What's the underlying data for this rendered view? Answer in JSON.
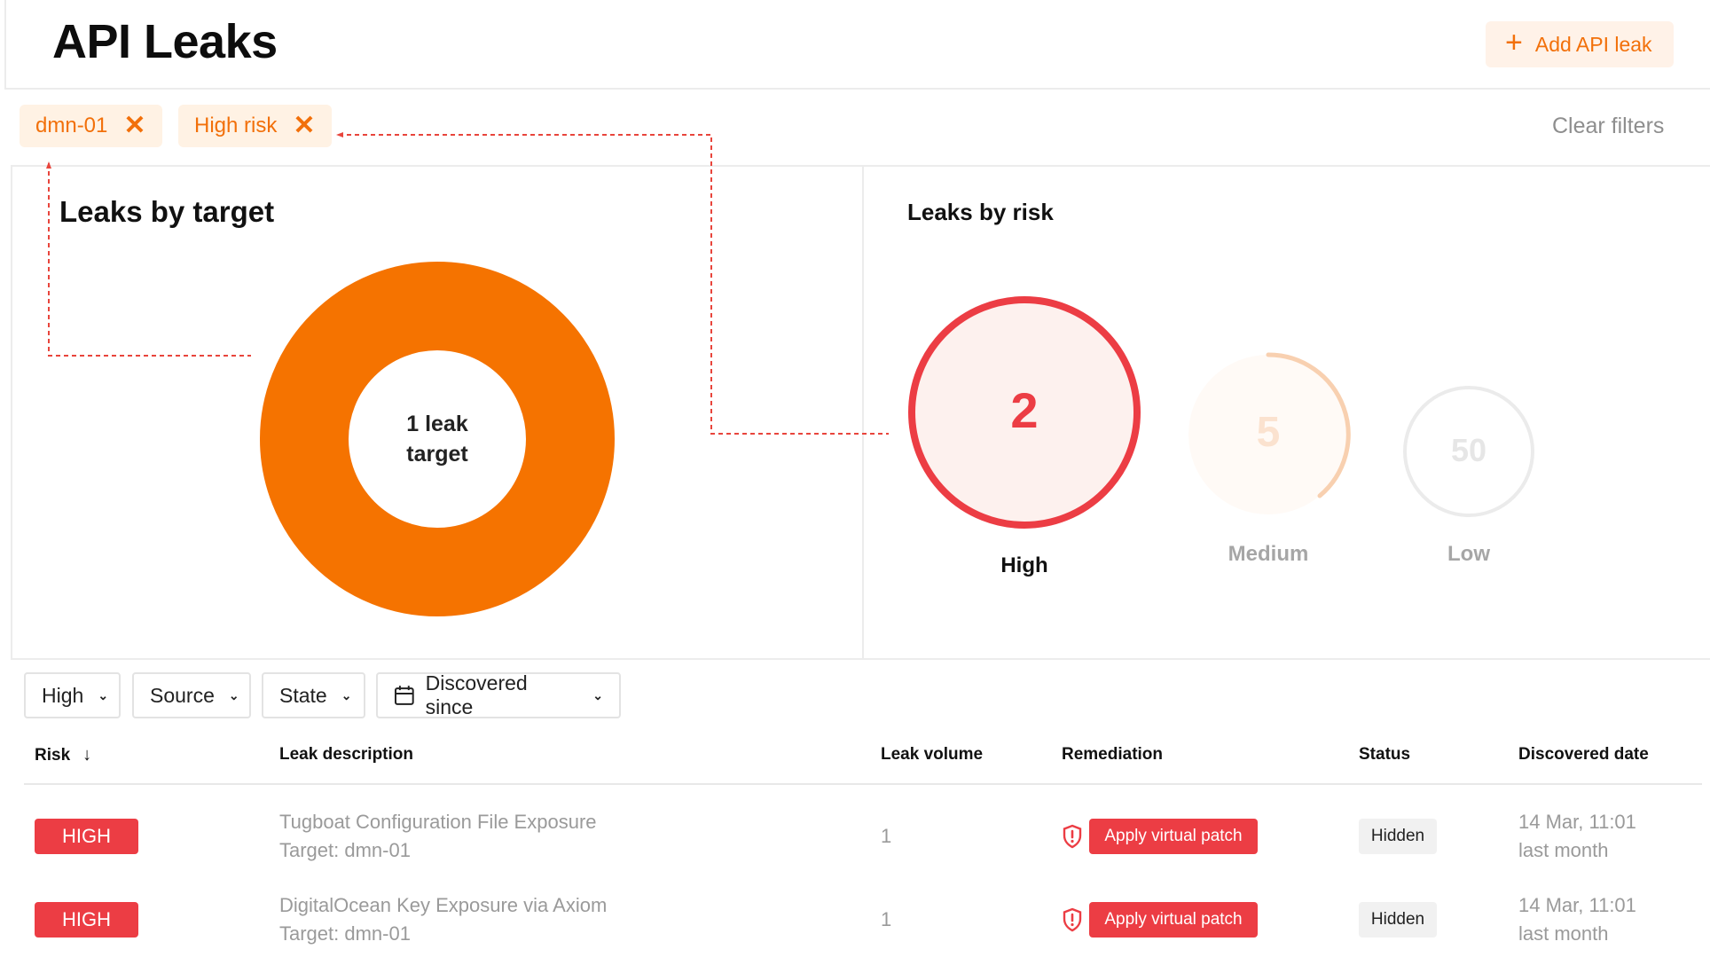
{
  "header": {
    "title": "API Leaks",
    "add_button": "Add API leak",
    "add_icon": "plus-icon"
  },
  "active_filters": [
    {
      "label": "dmn-01"
    },
    {
      "label": "High risk"
    }
  ],
  "clear_filters": "Clear filters",
  "leaks_by_target": {
    "title": "Leaks by target",
    "center_line1": "1 leak",
    "center_line2": "target",
    "color": "#f57300"
  },
  "leaks_by_risk": {
    "title": "Leaks by risk",
    "items": [
      {
        "value": "2",
        "label": "High",
        "color": "#ec3d44",
        "active": true
      },
      {
        "value": "5",
        "label": "Medium",
        "color": "#f7c7a0",
        "active": false
      },
      {
        "value": "50",
        "label": "Low",
        "color": "#e3e3e3",
        "active": false
      }
    ]
  },
  "table_filters": {
    "risk": "High",
    "source": "Source",
    "state": "State",
    "discovered": "Discovered since",
    "calendar_icon": "calendar-icon"
  },
  "table": {
    "columns": {
      "risk": "Risk",
      "description": "Leak description",
      "volume": "Leak volume",
      "remediation": "Remediation",
      "status": "Status",
      "date": "Discovered date"
    },
    "sort_icon": "arrow-down-icon",
    "rows": [
      {
        "risk": "HIGH",
        "title": "Tugboat Configuration File Exposure",
        "target": "Target: dmn-01",
        "volume": "1",
        "remediation": "Apply virtual patch",
        "status": "Hidden",
        "date": "14 Mar, 11:01",
        "relative": "last month"
      },
      {
        "risk": "HIGH",
        "title": "DigitalOcean Key Exposure via Axiom",
        "target": "Target: dmn-01",
        "volume": "1",
        "remediation": "Apply virtual patch",
        "status": "Hidden",
        "date": "14 Mar, 11:01",
        "relative": "last month"
      }
    ]
  },
  "colors": {
    "accent": "#f2700a",
    "danger": "#ec3d44",
    "annotation": "#e8453c"
  }
}
